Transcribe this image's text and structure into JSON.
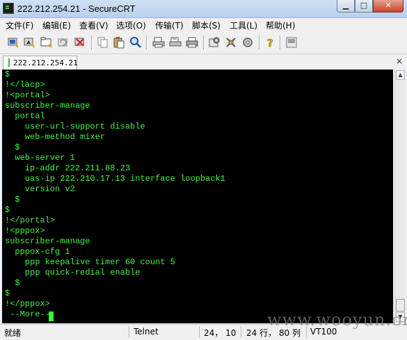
{
  "window": {
    "title": "222.212.254.21 - SecureCRT",
    "minimize_glyph": "▁",
    "maximize_glyph": "□",
    "close_glyph": "✕"
  },
  "menu": [
    "文件(F)",
    "编辑(E)",
    "查看(V)",
    "选项(O)",
    "传输(T)",
    "脚本(S)",
    "工具(L)",
    "帮助(H)"
  ],
  "toolbar": {
    "buttons": [
      {
        "name": "connect-icon"
      },
      {
        "name": "quick-connect-icon"
      },
      {
        "name": "connect-in-tab-icon"
      },
      {
        "name": "reconnect-icon"
      },
      {
        "name": "disconnect-icon"
      },
      {
        "name": "copy-icon"
      },
      {
        "name": "paste-icon"
      },
      {
        "name": "find-icon"
      },
      {
        "name": "print-screen-icon"
      },
      {
        "name": "print-selection-icon"
      },
      {
        "name": "print-icon"
      },
      {
        "name": "session-options-icon"
      },
      {
        "name": "global-options-icon"
      },
      {
        "name": "map-keys-icon"
      },
      {
        "name": "help-icon"
      },
      {
        "name": "sftp-icon"
      }
    ]
  },
  "tab": {
    "label": "222.212.254.21",
    "close_glyph": "×"
  },
  "terminal": {
    "fg_color": "#3ef43e",
    "bg_color": "#000000",
    "lines": [
      "$",
      "!</lacp>",
      "!<portal>",
      "subscriber-manage",
      "  portal",
      "    user-url-support disable",
      "    web-method mixer",
      "  $",
      "  web-server 1",
      "    ip-addr 222.211.88.23",
      "    uas-ip 222.210.17.13 interface loopback1",
      "    version v2",
      "  $",
      "$",
      "!</portal>",
      "!<pppox>",
      "subscriber-manage",
      "  pppox-cfg 1",
      "    ppp keepalive timer 60 count 5",
      "    ppp quick-redial enable",
      "  $",
      "$",
      "!</pppox>",
      " --More--"
    ]
  },
  "scrollbar": {
    "up_glyph": "▲",
    "down_glyph": "▼"
  },
  "status": {
    "ready": "就绪",
    "protocol": "Telnet",
    "cursor_pos": "24， 10",
    "size": "24 行， 80 列",
    "emulation": "VT100"
  },
  "watermark": "www.wooyun.org"
}
